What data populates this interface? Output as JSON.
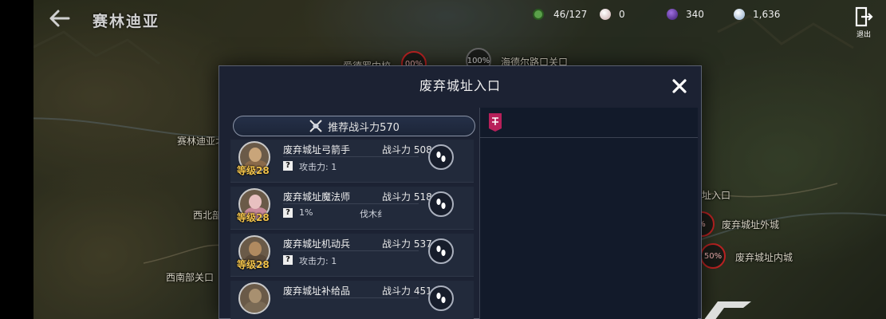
{
  "header": {
    "title": "赛林迪亚",
    "resources": [
      {
        "icon": "stamina-icon",
        "value": "46/127",
        "color": "#5aa04a"
      },
      {
        "icon": "pearl-icon",
        "value": "0",
        "color": "#d8c8c8"
      },
      {
        "icon": "purple-gem-icon",
        "value": "340",
        "color": "#6a3aa8"
      },
      {
        "icon": "crystal-icon",
        "value": "1,636",
        "color": "#c8d8e8"
      }
    ],
    "exit_label": "退出"
  },
  "map": {
    "labels": [
      {
        "text": "爱德罗中校",
        "name": "map-label-aide"
      },
      {
        "text": "海德尔路口关口",
        "name": "map-label-haide"
      },
      {
        "text": "赛林迪亚北",
        "name": "map-label-north"
      },
      {
        "text": "西北部",
        "name": "map-label-northwest"
      },
      {
        "text": "西南部关口",
        "name": "map-label-southwest"
      },
      {
        "text": "址入口",
        "name": "map-label-entrance"
      },
      {
        "text": "废弃城址外城",
        "name": "map-label-outer"
      },
      {
        "text": "废弃城址内城",
        "name": "map-label-inner"
      }
    ],
    "badges": [
      {
        "text": "00%",
        "name": "progress-badge-aide"
      },
      {
        "text": "100%",
        "name": "progress-badge-haide"
      },
      {
        "text": "%",
        "name": "progress-badge-outer"
      },
      {
        "text": "50%",
        "name": "progress-badge-inner"
      }
    ]
  },
  "dialog": {
    "title": "废弃城址入口",
    "recommended_power": "推荐战斗力570",
    "enemies": [
      {
        "name": "废弃城址弓箭手",
        "level": "等级28",
        "power": "战斗力 508",
        "skill": "攻击力: 1",
        "extra": "",
        "face": "#c9a57a",
        "body": "#8a6a4a"
      },
      {
        "name": "废弃城址魔法师",
        "level": "等级28",
        "power": "战斗力 518",
        "skill": "1%",
        "extra": "伐木纟",
        "face": "#e8c0c0",
        "body": "#c88a9a"
      },
      {
        "name": "废弃城址机动兵",
        "level": "等级28",
        "power": "战斗力 537",
        "skill": "攻击力: 1",
        "extra": "",
        "face": "#b08a60",
        "body": "#5a4a3a"
      },
      {
        "name": "废弃城址补给品",
        "level": "等级28",
        "power": "战斗力 451",
        "skill": "",
        "extra": "",
        "face": "#a89070",
        "body": "#7a6a55"
      }
    ]
  }
}
